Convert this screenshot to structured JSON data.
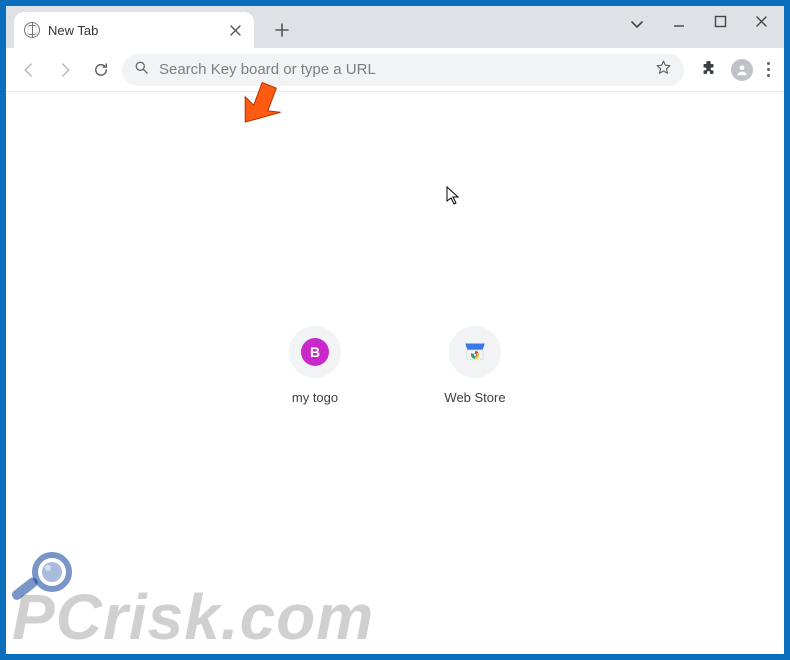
{
  "window": {
    "tab_title": "New Tab"
  },
  "toolbar": {
    "omnibox_placeholder": "Search Key board or type a URL"
  },
  "shortcuts": [
    {
      "label": "my togo",
      "badge": "B",
      "kind": "letter"
    },
    {
      "label": "Web Store",
      "kind": "webstore"
    }
  ],
  "watermark": {
    "text": "PCrisk.com"
  }
}
